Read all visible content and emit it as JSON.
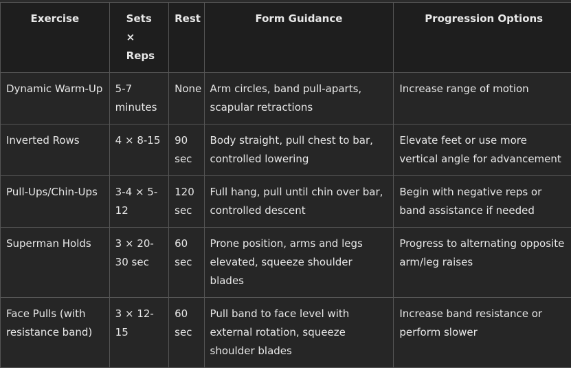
{
  "headers": [
    "Exercise",
    "Sets ×\nReps",
    "Rest",
    "Form Guidance",
    "Progression Options"
  ],
  "rows": [
    {
      "exercise": "Dynamic Warm-Up",
      "sets": "5-7 minutes",
      "rest": "None",
      "form": "Arm circles, band pull-aparts, scapular retractions",
      "progression": "Increase range of motion"
    },
    {
      "exercise": "Inverted Rows",
      "sets": "4 × 8-15",
      "rest": "90 sec",
      "form": "Body straight, pull chest to bar, controlled lowering",
      "progression": "Elevate feet or use more vertical angle for advancement"
    },
    {
      "exercise": "Pull-Ups/Chin-Ups",
      "sets": "3-4 × 5-12",
      "rest": "120 sec",
      "form": "Full hang, pull until chin over bar, controlled descent",
      "progression": "Begin with negative reps or band assistance if needed"
    },
    {
      "exercise": "Superman Holds",
      "sets": "3 × 20-30 sec",
      "rest": "60 sec",
      "form": "Prone position, arms and legs elevated, squeeze shoulder blades",
      "progression": "Progress to alternating opposite arm/leg raises"
    },
    {
      "exercise": "Face Pulls (with resistance band)",
      "sets": "3 × 12-15",
      "rest": "60 sec",
      "form": "Pull band to face level with external rotation, squeeze shoulder blades",
      "progression": "Increase band resistance or perform slower"
    }
  ]
}
